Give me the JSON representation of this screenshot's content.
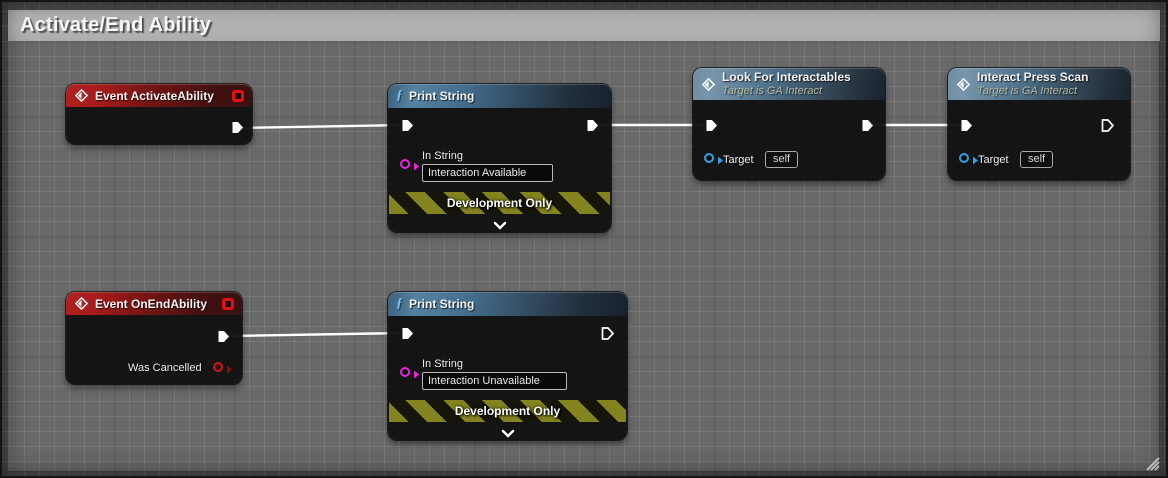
{
  "comment": {
    "title": "Activate/End Ability"
  },
  "colors": {
    "event_header": "#a51c1c",
    "function_header": "#5483a2",
    "exec_wire": "#ffffff",
    "string_pin": "#ec26d8",
    "object_pin": "#2aa3e8",
    "bool_pin": "#c81a1a",
    "dev_banner_stripe": "#83831f"
  },
  "icons": {
    "function_glyph": "ƒ"
  },
  "nodes": {
    "event_activate": {
      "title": "Event ActivateAbility"
    },
    "print_string_1": {
      "title": "Print String",
      "in_string_label": "In String",
      "in_string_value": "Interaction Available",
      "banner": "Development Only"
    },
    "look_for_interactables": {
      "title": "Look For Interactables",
      "subtitle": "Target is GA Interact",
      "target_label": "Target",
      "target_value": "self"
    },
    "interact_press_scan": {
      "title": "Interact Press Scan",
      "subtitle": "Target is GA Interact",
      "target_label": "Target",
      "target_value": "self"
    },
    "event_on_end": {
      "title": "Event OnEndAbility",
      "was_cancelled_label": "Was Cancelled"
    },
    "print_string_2": {
      "title": "Print String",
      "in_string_label": "In String",
      "in_string_value": "Interaction Unavailable",
      "banner": "Development Only"
    }
  }
}
